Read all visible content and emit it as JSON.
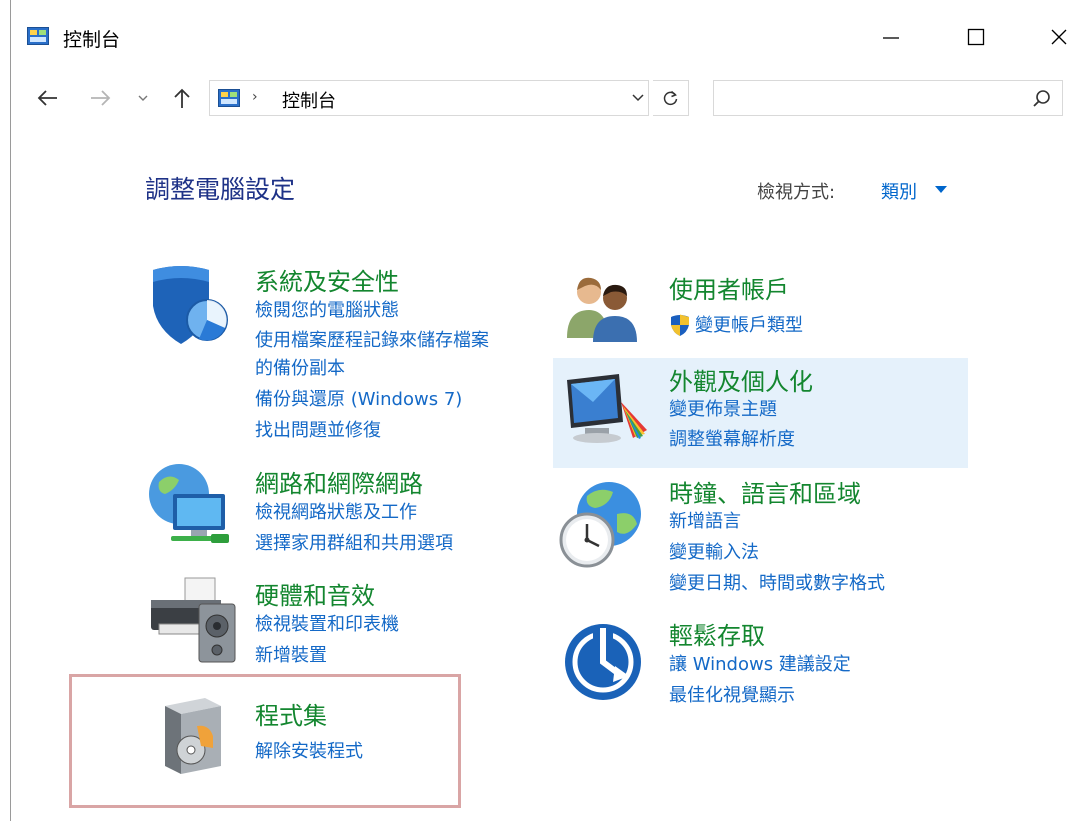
{
  "window": {
    "title": "控制台"
  },
  "addressbar": {
    "separator": "›",
    "path": "控制台"
  },
  "search": {
    "placeholder": ""
  },
  "content": {
    "heading": "調整電腦設定",
    "view_by_label": "檢視方式:",
    "view_by_value": "類別"
  },
  "categories": {
    "system": {
      "title": "系統及安全性",
      "links": [
        "檢閱您的電腦狀態",
        "使用檔案歷程記錄來儲存檔案",
        "的備份副本",
        "備份與還原 (Windows 7)",
        "找出問題並修復"
      ]
    },
    "network": {
      "title": "網路和網際網路",
      "links": [
        "檢視網路狀態及工作",
        "選擇家用群組和共用選項"
      ]
    },
    "hardware": {
      "title": "硬體和音效",
      "links": [
        "檢視裝置和印表機",
        "新增裝置"
      ]
    },
    "programs": {
      "title": "程式集",
      "links": [
        "解除安裝程式"
      ]
    },
    "users": {
      "title": "使用者帳戶",
      "links": [
        "變更帳戶類型"
      ]
    },
    "appearance": {
      "title": "外觀及個人化",
      "links": [
        "變更佈景主題",
        "調整螢幕解析度"
      ]
    },
    "clock": {
      "title": "時鐘、語言和區域",
      "links": [
        "新增語言",
        "變更輸入法",
        "變更日期、時間或數字格式"
      ]
    },
    "ease": {
      "title": "輕鬆存取",
      "links": [
        "讓 Windows 建議設定",
        "最佳化視覺顯示"
      ]
    }
  },
  "colors": {
    "category_title": "#13862f",
    "link": "#1469c7",
    "heading": "#1e3287",
    "hover_highlight": "#e5f1fb",
    "selection_border": "#d9a5a5"
  },
  "icons": {
    "system": "shield-icon",
    "network": "network-globe-icon",
    "hardware": "printer-speaker-icon",
    "programs": "software-box-icon",
    "users": "users-icon",
    "appearance": "monitor-palette-icon",
    "clock": "globe-clock-icon",
    "ease": "ease-of-access-icon"
  }
}
